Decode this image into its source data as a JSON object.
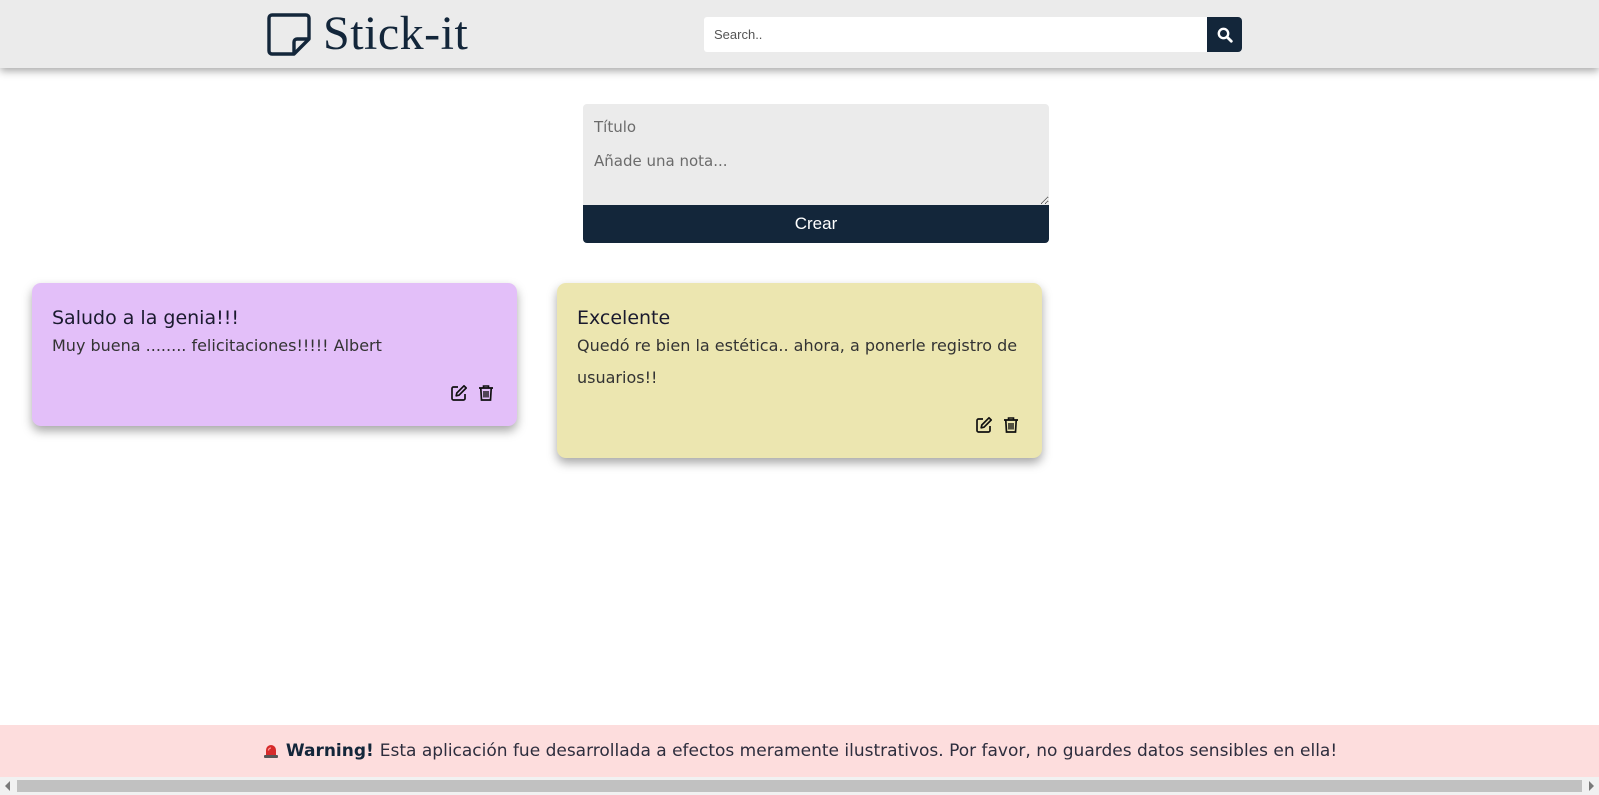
{
  "app": {
    "name": "Stick-it",
    "brand_color": "#13263a"
  },
  "header": {
    "logo_icon": "sticky-note-icon",
    "search": {
      "placeholder": "Search..",
      "value": "",
      "button_icon": "search-icon"
    }
  },
  "form": {
    "title_placeholder": "Título",
    "note_placeholder": "Añade una nota...",
    "create_label": "Crear"
  },
  "notes": [
    {
      "title": "Saludo a la genia!!!",
      "body": "Muy buena ........ felicitaciones!!!!! Albert",
      "color": "#e3bff9",
      "actions": [
        "edit-icon",
        "trash-icon"
      ]
    },
    {
      "title": "Excelente",
      "body": "Quedó re bien la estética.. ahora, a ponerle registro de usuarios!!",
      "color": "#ece6b0",
      "actions": [
        "edit-icon",
        "trash-icon"
      ]
    }
  ],
  "warning": {
    "icon": "siren-icon",
    "strong": "Warning!",
    "text": "Esta aplicación fue desarrollada a efectos meramente ilustrativos. Por favor, no guardes datos sensibles en ella!",
    "background": "#fddddd"
  }
}
